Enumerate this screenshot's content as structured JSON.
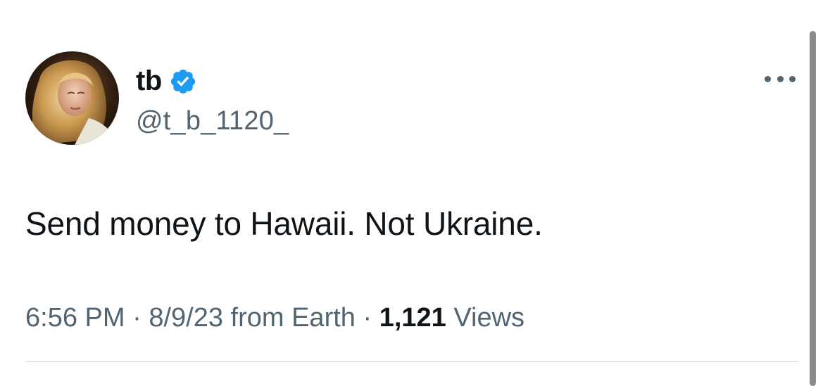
{
  "tweet": {
    "author": {
      "display_name": "tb",
      "handle": "@t_b_1120_",
      "verified": true,
      "verified_badge_color": "#1d9bf0",
      "avatar_icon": "profile-photo"
    },
    "more_icon": "more-options-icon",
    "text": "Send money to Hawaii. Not Ukraine.",
    "meta": {
      "time": "6:56 PM",
      "separator_1": " · ",
      "date": "8/9/23",
      "source": " from Earth",
      "separator_2": " · ",
      "views_count": "1,121",
      "views_label": " Views"
    }
  },
  "colors": {
    "text_primary": "#0f1419",
    "text_secondary": "#536471",
    "divider": "#cfd9de",
    "background": "#ffffff"
  }
}
